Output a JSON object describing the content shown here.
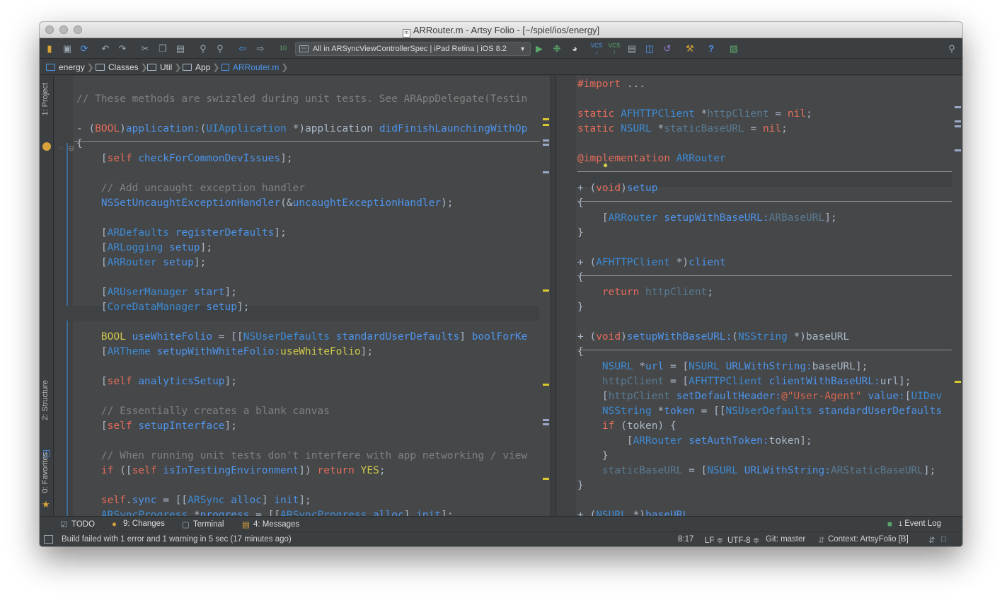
{
  "window": {
    "title": "ARRouter.m - Artsy Folio - [~/spiel/ios/energy]"
  },
  "toolbar": {
    "run_configuration": "All in ARSyncViewControllerSpec | iPad Retina | iOS 8.2",
    "icons": [
      "open-folder-icon",
      "save-icon",
      "sync-icon",
      "undo-icon",
      "redo-icon",
      "cut-icon",
      "copy-icon",
      "paste-icon",
      "find-icon",
      "replace-icon",
      "back-icon",
      "forward-icon",
      "build-icon",
      "run-icon",
      "debug-icon",
      "coverage-icon",
      "vcs-update-icon",
      "vcs-commit-icon",
      "vcs-history-icon",
      "structure-icon",
      "revert-icon",
      "settings-icon",
      "help-icon",
      "android-icon",
      "search-everywhere-icon"
    ]
  },
  "navbar": {
    "crumbs": [
      "energy",
      "Classes",
      "Util",
      "App",
      "ARRouter.m"
    ]
  },
  "left_stripe": {
    "project": "1: Project",
    "structure": "2: Structure",
    "favorites": "0: Favorites"
  },
  "left_editor": {
    "lines": [
      [
        [
          "cm",
          "// These methods are swizzled during unit tests. See ARAppDelegate(Testin"
        ]
      ],
      [
        [
          "id",
          "- ("
        ],
        [
          "kw",
          "BOOL"
        ],
        [
          "id",
          ")"
        ],
        [
          "me",
          "application:"
        ],
        [
          "id",
          "("
        ],
        [
          "ty",
          "UIApplication"
        ],
        [
          "id",
          " *)"
        ],
        [
          "id",
          "application "
        ],
        [
          "me",
          "didFinishLaunchingWithOp"
        ]
      ],
      [
        [
          "id",
          "{"
        ]
      ],
      [
        [
          "id",
          "    ["
        ],
        [
          "kw",
          "self "
        ],
        [
          "me",
          "checkForCommonDevIssues"
        ],
        [
          "id",
          "];"
        ]
      ],
      [
        [
          "id",
          ""
        ]
      ],
      [
        [
          "cm",
          "    // Add uncaught exception handler"
        ]
      ],
      [
        [
          "me",
          "    NSSetUncaughtExceptionHandler"
        ],
        [
          "id",
          "(&"
        ],
        [
          "me",
          "uncaughtExceptionHandler"
        ],
        [
          "id",
          ");"
        ]
      ],
      [
        [
          "id",
          ""
        ]
      ],
      [
        [
          "id",
          "    ["
        ],
        [
          "ty",
          "ARDefaults "
        ],
        [
          "me",
          "registerDefaults"
        ],
        [
          "id",
          "];"
        ]
      ],
      [
        [
          "id",
          "    ["
        ],
        [
          "ty",
          "ARLogging "
        ],
        [
          "me",
          "setup"
        ],
        [
          "id",
          "];"
        ]
      ],
      [
        [
          "id",
          "    ["
        ],
        [
          "ty",
          "ARRouter "
        ],
        [
          "me",
          "setup"
        ],
        [
          "id",
          "];"
        ]
      ],
      [
        [
          "id",
          ""
        ]
      ],
      [
        [
          "id",
          "    ["
        ],
        [
          "ty",
          "ARUserManager "
        ],
        [
          "me",
          "start"
        ],
        [
          "id",
          "];"
        ]
      ],
      [
        [
          "id",
          "    ["
        ],
        [
          "ty",
          "CoreDataManager "
        ],
        [
          "me",
          "setup"
        ],
        [
          "id",
          "];"
        ]
      ],
      [
        [
          "id",
          ""
        ]
      ],
      [
        [
          "lt",
          "    BOOL "
        ],
        [
          "me",
          "useWhiteFolio"
        ],
        [
          "id",
          " = [["
        ],
        [
          "ty",
          "NSUserDefaults "
        ],
        [
          "me",
          "standardUserDefaults"
        ],
        [
          "id",
          "] "
        ],
        [
          "me",
          "boolForKe"
        ]
      ],
      [
        [
          "id",
          "    ["
        ],
        [
          "ty",
          "ARTheme "
        ],
        [
          "me",
          "setupWithWhiteFolio:"
        ],
        [
          "lt",
          "useWhiteFolio"
        ],
        [
          "id",
          "];"
        ]
      ],
      [
        [
          "id",
          ""
        ]
      ],
      [
        [
          "id",
          "    ["
        ],
        [
          "kw",
          "self "
        ],
        [
          "me",
          "analyticsSetup"
        ],
        [
          "id",
          "];"
        ]
      ],
      [
        [
          "id",
          ""
        ]
      ],
      [
        [
          "cm",
          "    // Essentially creates a blank canvas"
        ]
      ],
      [
        [
          "id",
          "    ["
        ],
        [
          "kw",
          "self "
        ],
        [
          "me",
          "setupInterface"
        ],
        [
          "id",
          "];"
        ]
      ],
      [
        [
          "id",
          ""
        ]
      ],
      [
        [
          "cm",
          "    // When running unit tests don't interfere with app networking / view"
        ]
      ],
      [
        [
          "kw",
          "    if "
        ],
        [
          "id",
          "(["
        ],
        [
          "kw",
          "self "
        ],
        [
          "me",
          "isInTestingEnvironment"
        ],
        [
          "id",
          "]) "
        ],
        [
          "kw",
          "return "
        ],
        [
          "lt",
          "YES"
        ],
        [
          "id",
          ";"
        ]
      ],
      [
        [
          "id",
          ""
        ]
      ],
      [
        [
          "kw",
          "    self"
        ],
        [
          "id",
          "."
        ],
        [
          "me",
          "sync"
        ],
        [
          "id",
          " = [["
        ],
        [
          "ty",
          "ARSync "
        ],
        [
          "me",
          "alloc"
        ],
        [
          "id",
          "] "
        ],
        [
          "me",
          "init"
        ],
        [
          "id",
          "];"
        ]
      ],
      [
        [
          "ty",
          "    ARSyncProgress "
        ],
        [
          "id",
          "*"
        ],
        [
          "me",
          "progress"
        ],
        [
          "id",
          " = [["
        ],
        [
          "ty",
          "ARSyncProgress "
        ],
        [
          "me",
          "alloc"
        ],
        [
          "id",
          "] "
        ],
        [
          "me",
          "init"
        ],
        [
          "id",
          "];"
        ]
      ]
    ]
  },
  "right_editor": {
    "lines": [
      [
        [
          "kw",
          "#import "
        ],
        [
          "id",
          "..."
        ]
      ],
      [
        [
          "id",
          ""
        ]
      ],
      [
        [
          "kw",
          "static "
        ],
        [
          "ty",
          "AFHTTPClient "
        ],
        [
          "id",
          "*"
        ],
        [
          "fd",
          "httpClient"
        ],
        [
          "id",
          " = "
        ],
        [
          "kw",
          "nil"
        ],
        [
          "id",
          ";"
        ]
      ],
      [
        [
          "kw",
          "static "
        ],
        [
          "ty",
          "NSURL "
        ],
        [
          "id",
          "*"
        ],
        [
          "fd",
          "staticBaseURL"
        ],
        [
          "id",
          " = "
        ],
        [
          "kw",
          "nil"
        ],
        [
          "id",
          ";"
        ]
      ],
      [
        [
          "id",
          ""
        ]
      ],
      [
        [
          "kw",
          "@implementation "
        ],
        [
          "ty",
          "ARRouter"
        ]
      ],
      [
        [
          "id",
          ""
        ]
      ],
      [
        [
          "id",
          "+ ("
        ],
        [
          "kw",
          "void"
        ],
        [
          "id",
          ")"
        ],
        [
          "me",
          "setup"
        ]
      ],
      [
        [
          "id",
          "{"
        ]
      ],
      [
        [
          "id",
          "    ["
        ],
        [
          "ty",
          "ARRouter "
        ],
        [
          "me",
          "setupWithBaseURL:"
        ],
        [
          "fd",
          "ARBaseURL"
        ],
        [
          "id",
          "];"
        ]
      ],
      [
        [
          "id",
          "}"
        ]
      ],
      [
        [
          "id",
          ""
        ]
      ],
      [
        [
          "id",
          "+ ("
        ],
        [
          "ty",
          "AFHTTPClient "
        ],
        [
          "id",
          "*)"
        ],
        [
          "me",
          "client"
        ]
      ],
      [
        [
          "id",
          "{"
        ]
      ],
      [
        [
          "kw",
          "    return "
        ],
        [
          "fd",
          "httpClient"
        ],
        [
          "id",
          ";"
        ]
      ],
      [
        [
          "id",
          "}"
        ]
      ],
      [
        [
          "id",
          ""
        ]
      ],
      [
        [
          "id",
          "+ ("
        ],
        [
          "kw",
          "void"
        ],
        [
          "id",
          ")"
        ],
        [
          "me",
          "setupWithBaseURL:"
        ],
        [
          "id",
          "("
        ],
        [
          "ty",
          "NSString "
        ],
        [
          "id",
          "*)"
        ],
        [
          "id",
          "baseURL"
        ]
      ],
      [
        [
          "id",
          "{"
        ]
      ],
      [
        [
          "ty",
          "    NSURL "
        ],
        [
          "id",
          "*"
        ],
        [
          "me",
          "url"
        ],
        [
          "id",
          " = ["
        ],
        [
          "ty",
          "NSURL "
        ],
        [
          "me",
          "URLWithString:"
        ],
        [
          "id",
          "baseURL];"
        ]
      ],
      [
        [
          "fd",
          "    httpClient"
        ],
        [
          "id",
          " = ["
        ],
        [
          "ty",
          "AFHTTPClient "
        ],
        [
          "me",
          "clientWithBaseURL:"
        ],
        [
          "id",
          "url];"
        ]
      ],
      [
        [
          "id",
          "    ["
        ],
        [
          "fd",
          "httpClient "
        ],
        [
          "me",
          "setDefaultHeader:"
        ],
        [
          "st",
          "@\"User-Agent\" "
        ],
        [
          "me",
          "value:"
        ],
        [
          "id",
          "["
        ],
        [
          "ty",
          "UIDev"
        ]
      ],
      [
        [
          "ty",
          "    NSString "
        ],
        [
          "id",
          "*"
        ],
        [
          "me",
          "token"
        ],
        [
          "id",
          " = [["
        ],
        [
          "ty",
          "NSUserDefaults "
        ],
        [
          "me",
          "standardUserDefaults"
        ]
      ],
      [
        [
          "kw",
          "    if "
        ],
        [
          "id",
          "(token) {"
        ]
      ],
      [
        [
          "id",
          "        ["
        ],
        [
          "ty",
          "ARRouter "
        ],
        [
          "me",
          "setAuthToken:"
        ],
        [
          "id",
          "token];"
        ]
      ],
      [
        [
          "id",
          "    }"
        ]
      ],
      [
        [
          "fd",
          "    staticBaseURL"
        ],
        [
          "id",
          " = ["
        ],
        [
          "ty",
          "NSURL "
        ],
        [
          "me",
          "URLWithString:"
        ],
        [
          "fd",
          "ARStaticBaseURL"
        ],
        [
          "id",
          "];"
        ]
      ],
      [
        [
          "id",
          "}"
        ]
      ],
      [
        [
          "id",
          ""
        ]
      ],
      [
        [
          "id",
          "+ ("
        ],
        [
          "ty",
          "NSURL "
        ],
        [
          "id",
          "*)"
        ],
        [
          "me",
          "baseURL"
        ]
      ]
    ]
  },
  "bottom_tabs": {
    "todo": "TODO",
    "changes": "9: Changes",
    "terminal": "Terminal",
    "messages": "4: Messages",
    "event_log": "Event Log",
    "event_count": "1"
  },
  "status": {
    "message": "Build failed with 1 error and 1 warning in 5 sec (17 minutes ago)",
    "position": "8:17",
    "line_sep": "LF ≑",
    "encoding": "UTF-8 ≑",
    "git": "Git: master",
    "context": "Context: ArtsyFolio [B]"
  },
  "colors": {
    "comment": "#808080",
    "keyword": "#e56c5a",
    "type": "#3e8bd4",
    "method": "#4e94ea",
    "literal": "#d0c94a",
    "field": "#5a7b92",
    "identifier": "#a9b7c6",
    "string": "#d6654d",
    "editor_bg": "#454749"
  }
}
